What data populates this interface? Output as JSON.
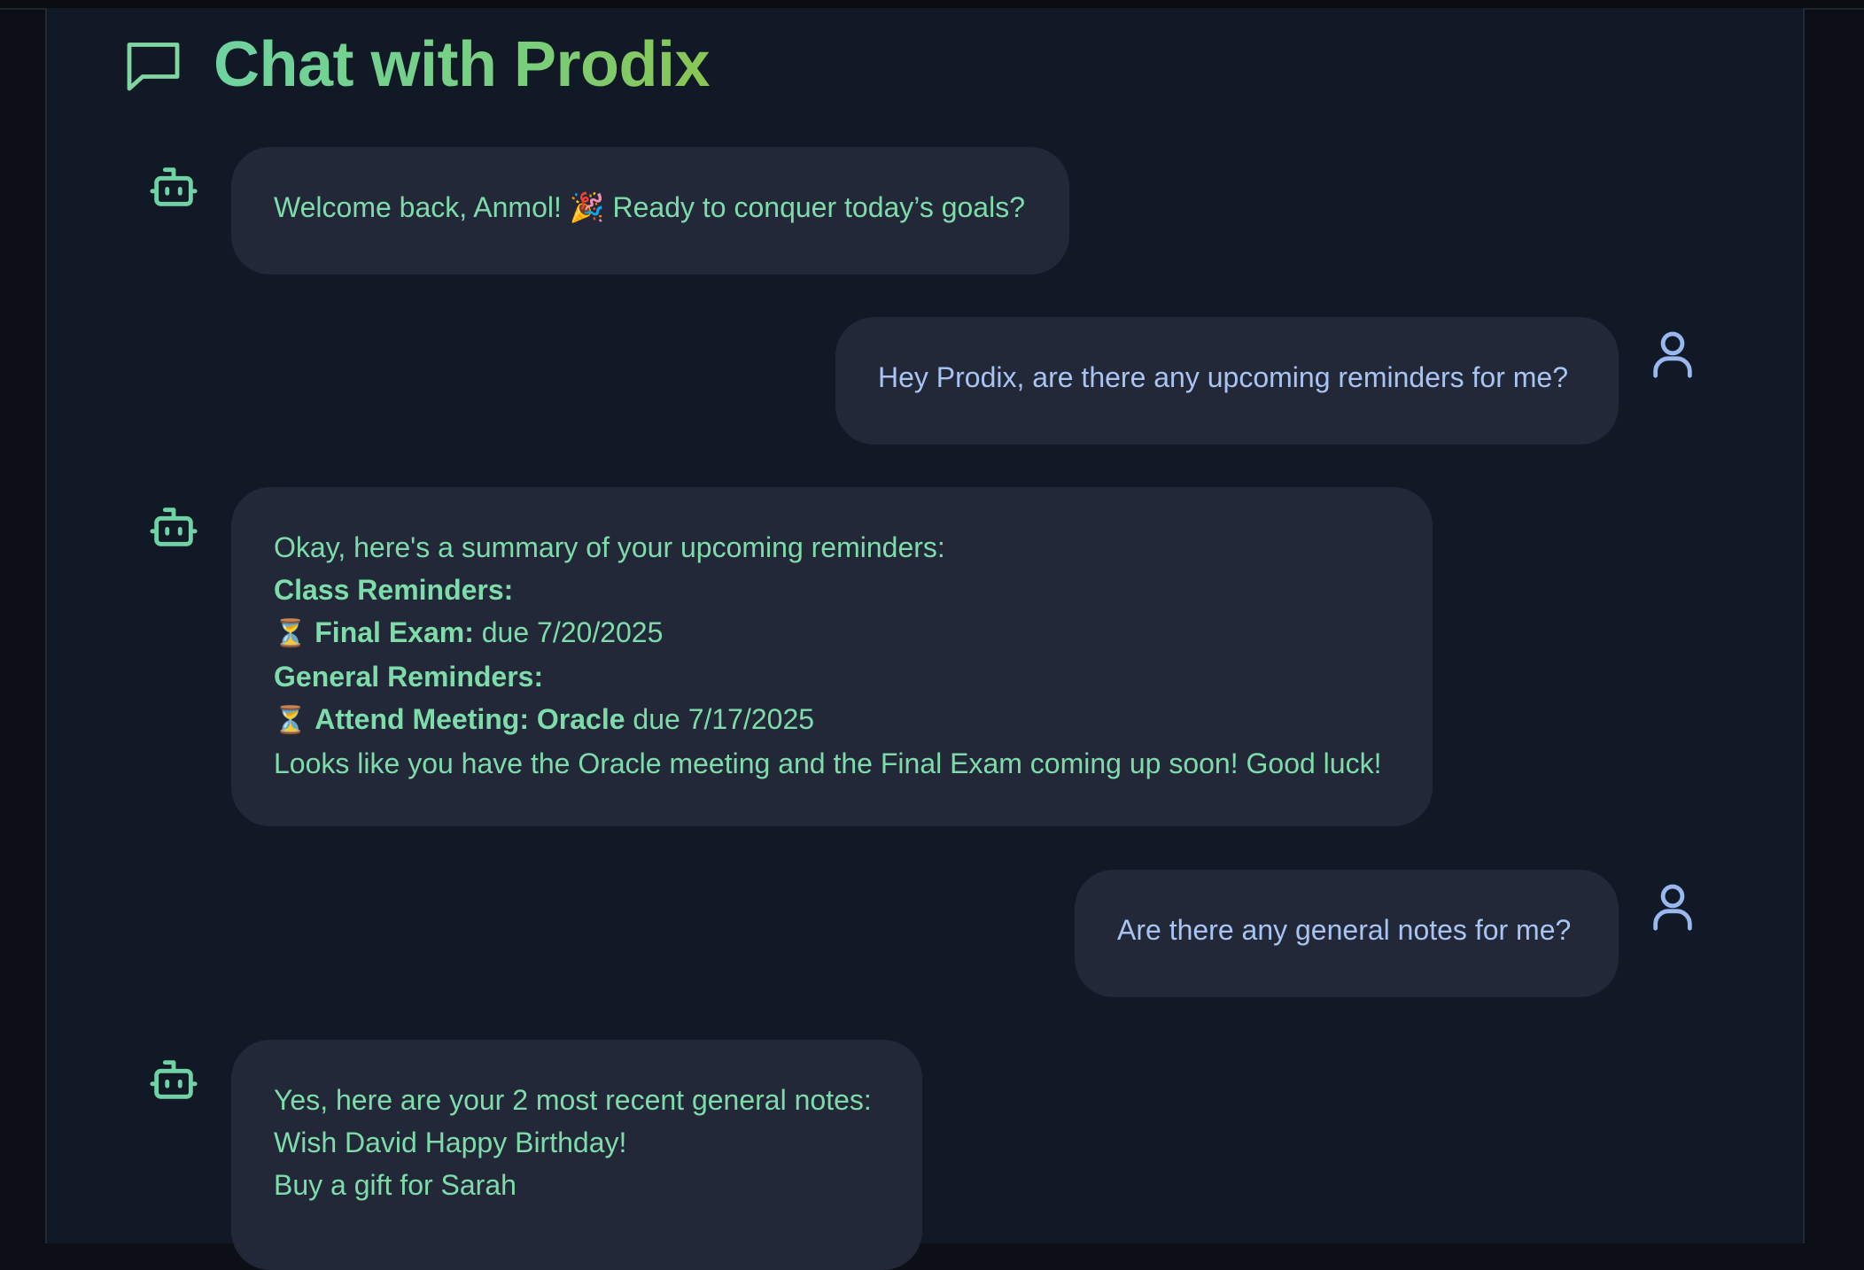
{
  "header": {
    "title": "Chat with Prodix",
    "icon": "message-square-icon"
  },
  "colors": {
    "bot_text": "#7edcab",
    "user_text": "#a9c4f2",
    "bubble_bg": "#222837",
    "panel_bg": "#111826"
  },
  "messages": [
    {
      "role": "bot",
      "text": "Welcome back, Anmol! 🎉 Ready to conquer today’s goals?"
    },
    {
      "role": "user",
      "text": "Hey Prodix, are there any upcoming reminders for me?"
    },
    {
      "role": "bot",
      "intro": "Okay, here's a summary of your upcoming reminders:",
      "class_heading": "Class Reminders:",
      "class_item": {
        "emoji": "⏳",
        "label": "Final Exam:",
        "due": "due 7/20/2025"
      },
      "general_heading": "General Reminders:",
      "general_item": {
        "emoji": "⏳",
        "label": "Attend Meeting: Oracle",
        "due": "due 7/17/2025"
      },
      "outro": "Looks like you have the Oracle meeting and the Final Exam coming up soon! Good luck!"
    },
    {
      "role": "user",
      "text": "Are there any general notes for me?"
    },
    {
      "role": "bot",
      "intro": "Yes, here are your 2 most recent general notes:",
      "notes": [
        "Wish David Happy Birthday!",
        "Buy a gift for Sarah"
      ]
    }
  ]
}
